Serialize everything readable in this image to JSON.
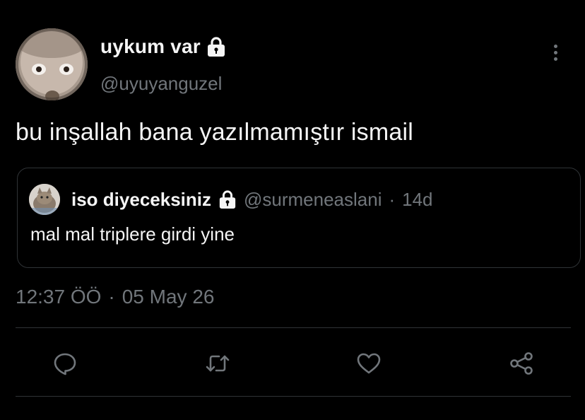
{
  "tweet": {
    "author": {
      "display_name": "uykum var",
      "handle": "@uyuyanguzel",
      "protected_icon": "lock-icon"
    },
    "text": "bu inşallah bana yazılmamıştır ismail",
    "quoted": {
      "display_name": "iso diyeceksiniz",
      "handle": "@surmeneaslani",
      "separator": "·",
      "age": "14d",
      "text": "mal mal triplere girdi yine",
      "protected_icon": "lock-icon"
    },
    "time": "12:37 ÖÖ",
    "time_separator": "·",
    "date": "05 May 26"
  },
  "actions": [
    {
      "name": "reply",
      "icon": "reply-icon"
    },
    {
      "name": "retweet",
      "icon": "retweet-icon"
    },
    {
      "name": "like",
      "icon": "heart-icon"
    },
    {
      "name": "share",
      "icon": "share-icon"
    }
  ],
  "colors": {
    "background": "#000000",
    "primary_text": "#f5f5f5",
    "secondary_text": "#71767b",
    "border": "#2f3336"
  }
}
